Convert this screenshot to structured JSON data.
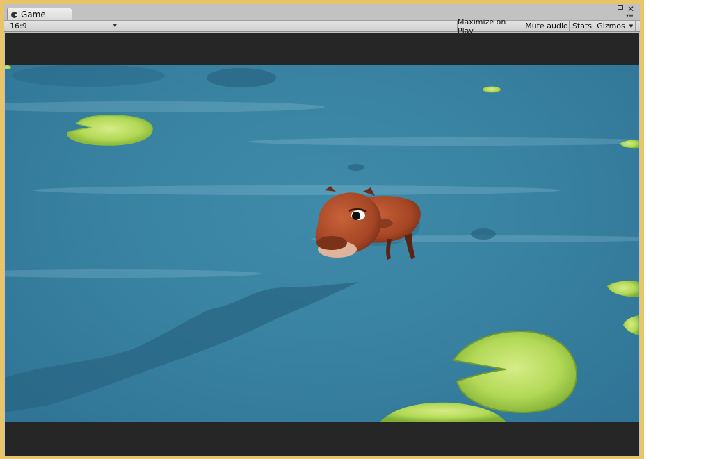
{
  "window": {
    "tab_title": "Game",
    "tab_icon": "unity-game-icon"
  },
  "toolbar": {
    "aspect_value": "16:9",
    "maximize_label": "Maximize on Play",
    "mute_label": "Mute audio",
    "stats_label": "Stats",
    "gizmos_label": "Gizmos"
  },
  "colors": {
    "window_border": "#e8c46a",
    "letterbox": "#262626",
    "water": "#3a84a3",
    "lilypad": "#a8d04a",
    "capybara": "#a8492a"
  }
}
